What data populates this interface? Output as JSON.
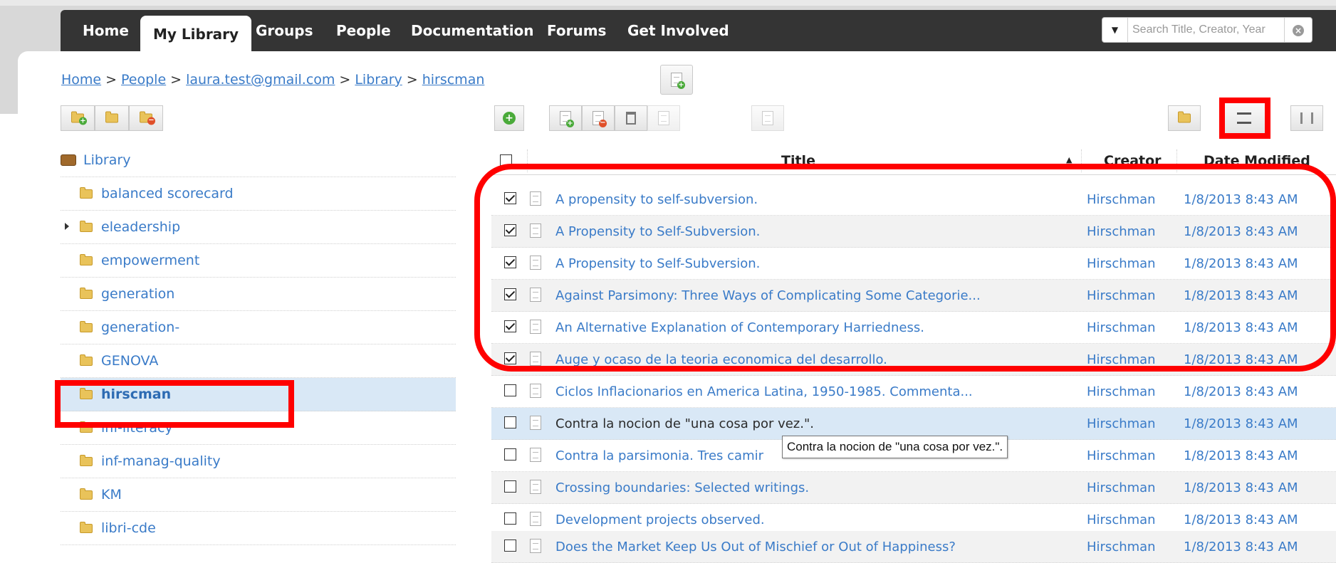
{
  "nav": {
    "items": [
      "Home",
      "My Library",
      "Groups",
      "People",
      "Documentation",
      "Forums",
      "Get Involved"
    ],
    "active": "My Library"
  },
  "search": {
    "placeholder": "Search Title, Creator, Year"
  },
  "breadcrumb": [
    "Home",
    "People",
    "laura.test@gmail.com",
    "Library",
    "hirscman"
  ],
  "sidebar": {
    "root": "Library",
    "folders": [
      "balanced scorecard",
      "eleadership",
      "empowerment",
      "generation",
      "generation-",
      "GENOVA",
      "hirscman",
      "inf-literacy",
      "inf-manag-quality",
      "KM",
      "libri-cde"
    ],
    "selected": "hirscman"
  },
  "table": {
    "columns": {
      "title": "Title",
      "creator": "Creator",
      "date": "Date Modified"
    },
    "rows": [
      {
        "title": "A propensity to self-subversion.",
        "creator": "Hirschman",
        "date": "1/8/2013 8:43 AM",
        "checked": true
      },
      {
        "title": "A Propensity to Self-Subversion.",
        "creator": "Hirschman",
        "date": "1/8/2013 8:43 AM",
        "checked": true
      },
      {
        "title": "A Propensity to Self-Subversion.",
        "creator": "Hirschman",
        "date": "1/8/2013 8:43 AM",
        "checked": true
      },
      {
        "title": "Against Parsimony: Three Ways of Complicating Some Categorie...",
        "creator": "Hirschman",
        "date": "1/8/2013 8:43 AM",
        "checked": true
      },
      {
        "title": "An Alternative Explanation of Contemporary Harriedness.",
        "creator": "Hirschman",
        "date": "1/8/2013 8:43 AM",
        "checked": true
      },
      {
        "title": "Auge y ocaso de la teoria economica del desarrollo.",
        "creator": "Hirschman",
        "date": "1/8/2013 8:43 AM",
        "checked": true
      },
      {
        "title": "Ciclos Inflacionarios en America Latina, 1950-1985. Commenta...",
        "creator": "Hirschman",
        "date": "1/8/2013 8:43 AM",
        "checked": false
      },
      {
        "title": "Contra la nocion de \"una cosa por vez.\".",
        "creator": "Hirschman",
        "date": "1/8/2013 8:43 AM",
        "checked": false
      },
      {
        "title": "Contra la parsimonia. Tres camir",
        "creator": "Hirschman",
        "date": "1/8/2013 8:43 AM",
        "checked": false
      },
      {
        "title": "Crossing boundaries: Selected writings.",
        "creator": "Hirschman",
        "date": "1/8/2013 8:43 AM",
        "checked": false
      },
      {
        "title": "Development projects observed.",
        "creator": "Hirschman",
        "date": "1/8/2013 8:43 AM",
        "checked": false
      },
      {
        "title": "Does the Market Keep Us Out of Mischief or Out of Happiness?",
        "creator": "Hirschman",
        "date": "1/8/2013 8:43 AM",
        "checked": false
      }
    ]
  },
  "tooltip": "Contra la nocion de \"una cosa por vez.\".",
  "colors": {
    "nav_bg": "#343434",
    "link": "#3a7bc8",
    "selected_bg": "#d9e8f6",
    "annotation": "#ff0000"
  }
}
